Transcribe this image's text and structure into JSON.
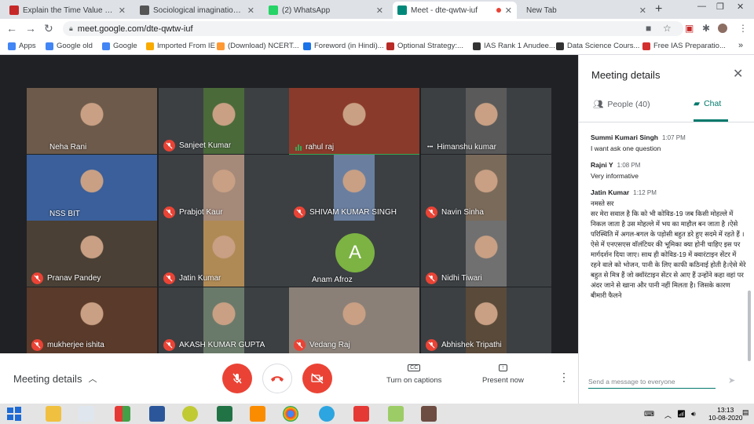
{
  "browser": {
    "tabs": [
      {
        "title": "Explain the Time Value of Mone",
        "favicon": "pdf-icon",
        "color": "#c62828",
        "active": false
      },
      {
        "title": "Sociological imagination - Wiki",
        "favicon": "wikipedia-icon",
        "color": "#555555",
        "active": false
      },
      {
        "title": "(2) WhatsApp",
        "favicon": "whatsapp-icon",
        "color": "#25d366",
        "active": false
      },
      {
        "title": "Meet - dte-qwtw-iuf",
        "favicon": "meet-icon",
        "color": "#00897b",
        "active": true
      },
      {
        "title": "New Tab",
        "favicon": "",
        "color": "",
        "active": false
      }
    ],
    "url": "meet.google.com/dte-qwtw-iuf",
    "bookmarks": [
      {
        "label": "Apps",
        "icon": "apps-grid-icon",
        "color": "#4285f4"
      },
      {
        "label": "Google old",
        "icon": "google-icon",
        "color": "#4285f4"
      },
      {
        "label": "Google",
        "icon": "google-icon",
        "color": "#4285f4"
      },
      {
        "label": "Imported From IE",
        "icon": "folder-icon",
        "color": "#f9ab00"
      },
      {
        "label": "(Download) NCERT...",
        "icon": "india-flag-icon",
        "color": "#ff9933"
      },
      {
        "label": "Foreword (in Hindi)...",
        "icon": "arrow-icon",
        "color": "#1a73e8"
      },
      {
        "label": "Optional Strategy:...",
        "icon": "quora-icon",
        "color": "#b92b27"
      },
      {
        "label": "IAS Rank 1 Anudee...",
        "icon": "ad-icon",
        "color": "#333333"
      },
      {
        "label": "Data Science Cours...",
        "icon": "globe-icon",
        "color": "#333333"
      },
      {
        "label": "Free IAS Preparatio...",
        "icon": "heart-icon",
        "color": "#d32f2f"
      }
    ]
  },
  "participants": [
    {
      "name": "Neha Rani",
      "muted": false,
      "speaking": false,
      "tint": "#6d5a4a"
    },
    {
      "name": "Sanjeet Kumar",
      "muted": true,
      "speaking": false,
      "tint": "#4a6a3a"
    },
    {
      "name": "rahul raj",
      "muted": false,
      "speaking": true,
      "tint": "#8a3a2a"
    },
    {
      "name": "Himanshu kumar",
      "muted": false,
      "speaking": false,
      "tint": "#5a5a5a",
      "dots": true
    },
    {
      "name": "NSS BIT",
      "muted": false,
      "speaking": false,
      "tint": "#3a5f9a"
    },
    {
      "name": "Prabjot Kaur",
      "muted": true,
      "speaking": false,
      "tint": "#a58a7a"
    },
    {
      "name": "SHIVAM KUMAR SINGH",
      "muted": true,
      "speaking": false,
      "tint": "#6a7fa0"
    },
    {
      "name": "Navin Sinha",
      "muted": true,
      "speaking": false,
      "tint": "#7a6a5a"
    },
    {
      "name": "Pranav Pandey",
      "muted": true,
      "speaking": false,
      "tint": "#4a4035"
    },
    {
      "name": "Jatin Kumar",
      "muted": true,
      "speaking": false,
      "tint": "#b08a55"
    },
    {
      "name": "Anam Afroz",
      "muted": false,
      "speaking": false,
      "tint": "",
      "avatar_letter": "A"
    },
    {
      "name": "Nidhi Tiwari",
      "muted": true,
      "speaking": false,
      "tint": "#707070"
    },
    {
      "name": "mukherjee ishita",
      "muted": true,
      "speaking": false,
      "tint": "#5a3a2a"
    },
    {
      "name": "AKASH KUMAR GUPTA",
      "muted": true,
      "speaking": false,
      "tint": "#6a7a6a"
    },
    {
      "name": "Vedang Raj",
      "muted": true,
      "speaking": false,
      "tint": "#8a8078"
    },
    {
      "name": "Abhishek Tripathi",
      "muted": true,
      "speaking": false,
      "tint": "#5a4a3a"
    }
  ],
  "bottom_bar": {
    "meeting_details": "Meeting details",
    "captions": "Turn on captions",
    "present": "Present now"
  },
  "panel": {
    "title": "Meeting details",
    "people_tab": "People (40)",
    "chat_tab": "Chat",
    "messages": [
      {
        "sender": "Summi Kumari Singh",
        "time": "1:07 PM",
        "text": "I want ask one question"
      },
      {
        "sender": "Rajni Y",
        "time": "1:08 PM",
        "text": "Very informative"
      },
      {
        "sender": "Jatin Kumar",
        "time": "1:12 PM",
        "text": "नमस्ते सर\nसर मेरा सवाल है कि को भी कोविड-19 जब किसी मोहल्ले में निकल जाता है उस मोहल्ले में भय का माहौल बन जाता है ।ऐसे परिस्थिति में अगल-बगल के पड़ोसी बहुत डरे हुए सदमे में रहते हैं ।ऐसे में एनएसएस वॉलंटियर की भूमिका क्या होनी चाहिए इस पर मार्गदर्शन दिया जाए। साथ ही कोविड-19 में क्वारंटाइन सेंटर में रहने वाले को भोजन, पानी के लिए काफी कठिनाई होती है।ऐसे मेरे बहुत से मित्र हैं जो क्वॉरंटाइन सेंटर से आए हैं उन्होंने कहा वहां पर अंदर जाने से खाना और पानी नहीं मिलता है। जिसके कारण बीमारी फैलने"
      }
    ],
    "composer_placeholder": "Send a message to everyone"
  },
  "taskbar": {
    "time": "13:13",
    "date": "10-08-2020"
  }
}
